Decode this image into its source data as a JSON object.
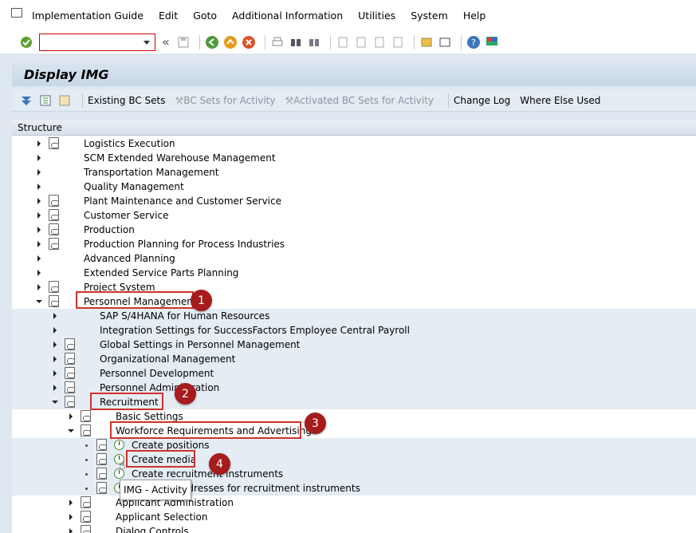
{
  "menubar": {
    "items": [
      {
        "label": "Implementation Guide"
      },
      {
        "label": "Edit"
      },
      {
        "label": "Goto"
      },
      {
        "label": "Additional Information"
      },
      {
        "label": "Utilities"
      },
      {
        "label": "System"
      },
      {
        "label": "Help"
      }
    ]
  },
  "toolbar": {
    "command_field_value": "",
    "collapse_label": "«"
  },
  "title": "Display IMG",
  "app_toolbar": {
    "existing_bc_sets": "Existing BC Sets",
    "bc_sets_for_activity": "BC Sets for Activity",
    "activated_bc_sets": "Activated BC Sets for Activity",
    "change_log": "Change Log",
    "where_else_used": "Where Else Used"
  },
  "tree": {
    "header": "Structure",
    "rows": [
      {
        "label": "Logistics Execution"
      },
      {
        "label": "SCM Extended Warehouse Management"
      },
      {
        "label": "Transportation Management"
      },
      {
        "label": "Quality Management"
      },
      {
        "label": "Plant Maintenance and Customer Service"
      },
      {
        "label": "Customer Service"
      },
      {
        "label": "Production"
      },
      {
        "label": "Production Planning for Process Industries"
      },
      {
        "label": "Advanced Planning"
      },
      {
        "label": "Extended Service Parts Planning"
      },
      {
        "label": "Project System"
      },
      {
        "label": "Personnel Management"
      },
      {
        "label": "SAP S/4HANA for Human Resources"
      },
      {
        "label": "Integration Settings for SuccessFactors Employee Central Payroll"
      },
      {
        "label": "Global Settings in Personnel Management"
      },
      {
        "label": "Organizational Management"
      },
      {
        "label": "Personnel Development"
      },
      {
        "label": "Personnel Administration"
      },
      {
        "label": "Recruitment"
      },
      {
        "label": "Basic Settings"
      },
      {
        "label": "Workforce Requirements and Advertising"
      },
      {
        "label": "Create positions"
      },
      {
        "label": "Create media"
      },
      {
        "label": "Create recruitment instruments"
      },
      {
        "label": "Maintain addresses for recruitment instruments"
      },
      {
        "label": "Applicant Administration"
      },
      {
        "label": "Applicant Selection"
      },
      {
        "label": "Dialog Controls"
      }
    ]
  },
  "badges": [
    "1",
    "2",
    "3",
    "4"
  ],
  "tooltip": "IMG - Activity",
  "colors": {
    "highlight": "#d0312d",
    "badge": "#a61c1c",
    "band": "#e4ecf4"
  }
}
